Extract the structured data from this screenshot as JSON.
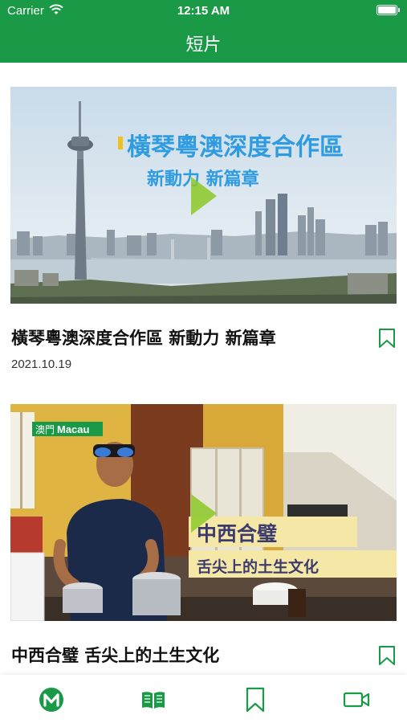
{
  "status_bar": {
    "carrier": "Carrier",
    "time": "12:15 AM"
  },
  "header": {
    "title": "短片"
  },
  "videos": [
    {
      "overlay_line1": "橫琴粵澳深度合作區",
      "overlay_line2": "新動力 新篇章",
      "title": "橫琴粵澳深度合作區 新動力 新篇章",
      "date": "2021.10.19"
    },
    {
      "logo_text_cn": "澳門",
      "logo_text_en": "Macau",
      "overlay_line1": "中西合璧",
      "overlay_line2": "舌尖上的土生文化",
      "title": "中西合璧 舌尖上的土生文化"
    }
  ],
  "tabbar": {
    "items": [
      "home-icon",
      "book-icon",
      "bookmark-icon",
      "video-icon"
    ]
  },
  "colors": {
    "brand": "#1a9a47",
    "overlay_blue": "#2f9be0",
    "overlay_box": "#f5e7a6"
  }
}
